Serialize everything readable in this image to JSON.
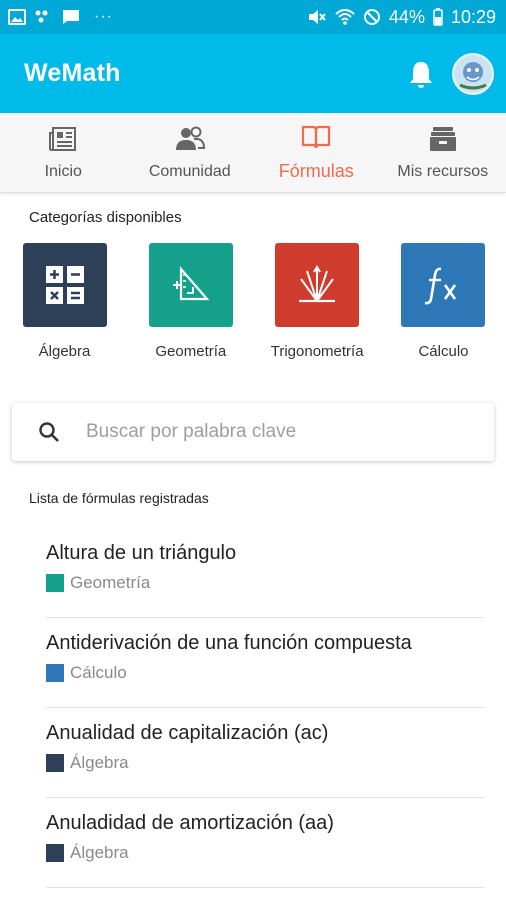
{
  "status_bar": {
    "battery": "44%",
    "time": "10:29",
    "more": "···"
  },
  "app_bar": {
    "title": "WeMath"
  },
  "tabs": [
    {
      "label": "Inicio",
      "icon": "news-icon",
      "active": false
    },
    {
      "label": "Comunidad",
      "icon": "people-icon",
      "active": false
    },
    {
      "label": "Fórmulas",
      "icon": "book-icon",
      "active": true
    },
    {
      "label": "Mis recursos",
      "icon": "archive-icon",
      "active": false
    }
  ],
  "categories": {
    "title": "Categorías disponibles",
    "items": [
      {
        "label": "Álgebra",
        "color": "#2e4058",
        "icon": "calculator-icon"
      },
      {
        "label": "Geometría",
        "color": "#14a08b",
        "icon": "triangle-ruler-icon"
      },
      {
        "label": "Trigonometría",
        "color": "#cf3b2c",
        "icon": "trig-vectors-icon"
      },
      {
        "label": "Cálculo",
        "color": "#2f78b7",
        "icon": "fx-icon"
      }
    ]
  },
  "search": {
    "placeholder": "Buscar por palabra clave",
    "value": ""
  },
  "formula_list": {
    "title": "Lista de fórmulas registradas",
    "items": [
      {
        "title": "Altura de un triángulo",
        "category": "Geometría",
        "color": "#14a08b"
      },
      {
        "title": "Antiderivación de una función compuesta",
        "category": "Cálculo",
        "color": "#2f78b7"
      },
      {
        "title": "Anualidad de capitalización (ac)",
        "category": "Álgebra",
        "color": "#2e4058"
      },
      {
        "title": "Anuladidad de amortización (aa)",
        "category": "Álgebra",
        "color": "#2e4058"
      }
    ]
  },
  "colors": {
    "status_bar": "#00a8d6",
    "app_bar": "#00bbe9",
    "active_tab": "#f06b4a"
  }
}
